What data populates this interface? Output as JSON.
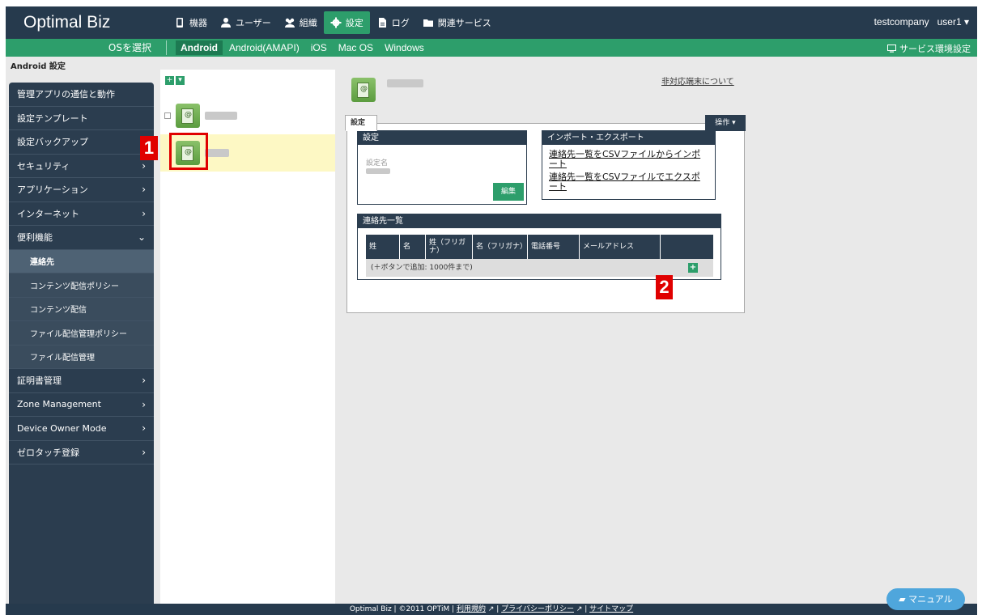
{
  "app": {
    "logo": "Optimal Biz"
  },
  "topnav": [
    {
      "label": "機器",
      "icon": "phone-icon"
    },
    {
      "label": "ユーザー",
      "icon": "user-icon"
    },
    {
      "label": "組織",
      "icon": "group-icon"
    },
    {
      "label": "設定",
      "icon": "gear-icon",
      "active": true
    },
    {
      "label": "ログ",
      "icon": "document-icon"
    },
    {
      "label": "関連サービス",
      "icon": "folder-icon"
    }
  ],
  "account": {
    "company": "testcompany",
    "user": "user1 ▾"
  },
  "osbar": {
    "select_label": "OSを選択",
    "tabs": [
      "Android",
      "Android(AMAPI)",
      "iOS",
      "Mac OS",
      "Windows"
    ],
    "service_settings": "サービス環境設定"
  },
  "sidebar": {
    "title": "Android 設定",
    "items": [
      {
        "label": "管理アプリの通信と動作",
        "chevron": ""
      },
      {
        "label": "設定テンプレート",
        "chevron": ""
      },
      {
        "label": "設定バックアップ",
        "chevron": ""
      },
      {
        "label": "セキュリティ",
        "chevron": "›"
      },
      {
        "label": "アプリケーション",
        "chevron": "›"
      },
      {
        "label": "インターネット",
        "chevron": "›"
      },
      {
        "label": "便利機能",
        "chevron": "⌄"
      },
      {
        "label": "連絡先",
        "sub": true,
        "active": true
      },
      {
        "label": "コンテンツ配信ポリシー",
        "sub": true
      },
      {
        "label": "コンテンツ配信",
        "sub": true
      },
      {
        "label": "ファイル配信管理ポリシー",
        "sub": true
      },
      {
        "label": "ファイル配信管理",
        "sub": true
      },
      {
        "label": "証明書管理",
        "chevron": "›"
      },
      {
        "label": "Zone Management",
        "chevron": "›"
      },
      {
        "label": "Device Owner Mode",
        "chevron": "›"
      },
      {
        "label": "ゼロタッチ登録",
        "chevron": "›"
      }
    ]
  },
  "callouts": {
    "one": "1",
    "two": "2"
  },
  "main": {
    "unsupported_link": "非対応端末について",
    "tab_label": "設定",
    "operation_button": "操作 ▾",
    "settings_box": {
      "title": "設定",
      "name_label": "設定名",
      "edit_button": "編集"
    },
    "import_box": {
      "title": "インポート・エクスポート",
      "import_link": "連絡先一覧をCSVファイルからインポート",
      "export_link": "連絡先一覧をCSVファイルでエクスポート"
    },
    "contacts": {
      "title": "連絡先一覧",
      "columns": [
        "姓",
        "名",
        "姓（フリガナ）",
        "名（フリガナ）",
        "電話番号",
        "メールアドレス",
        ""
      ],
      "empty_text": "(＋ボタンで追加: 1000件まで)",
      "add_button": "+"
    }
  },
  "footer": {
    "text": "Optimal Biz | ©2011 OPTiM |",
    "links": [
      "利用規約",
      "プライバシーポリシー",
      "サイトマップ"
    ]
  },
  "manual_button": "マニュアル",
  "colors": {
    "navy": "#263a4d",
    "green": "#2d9e6b",
    "callout_red": "#e00000"
  }
}
